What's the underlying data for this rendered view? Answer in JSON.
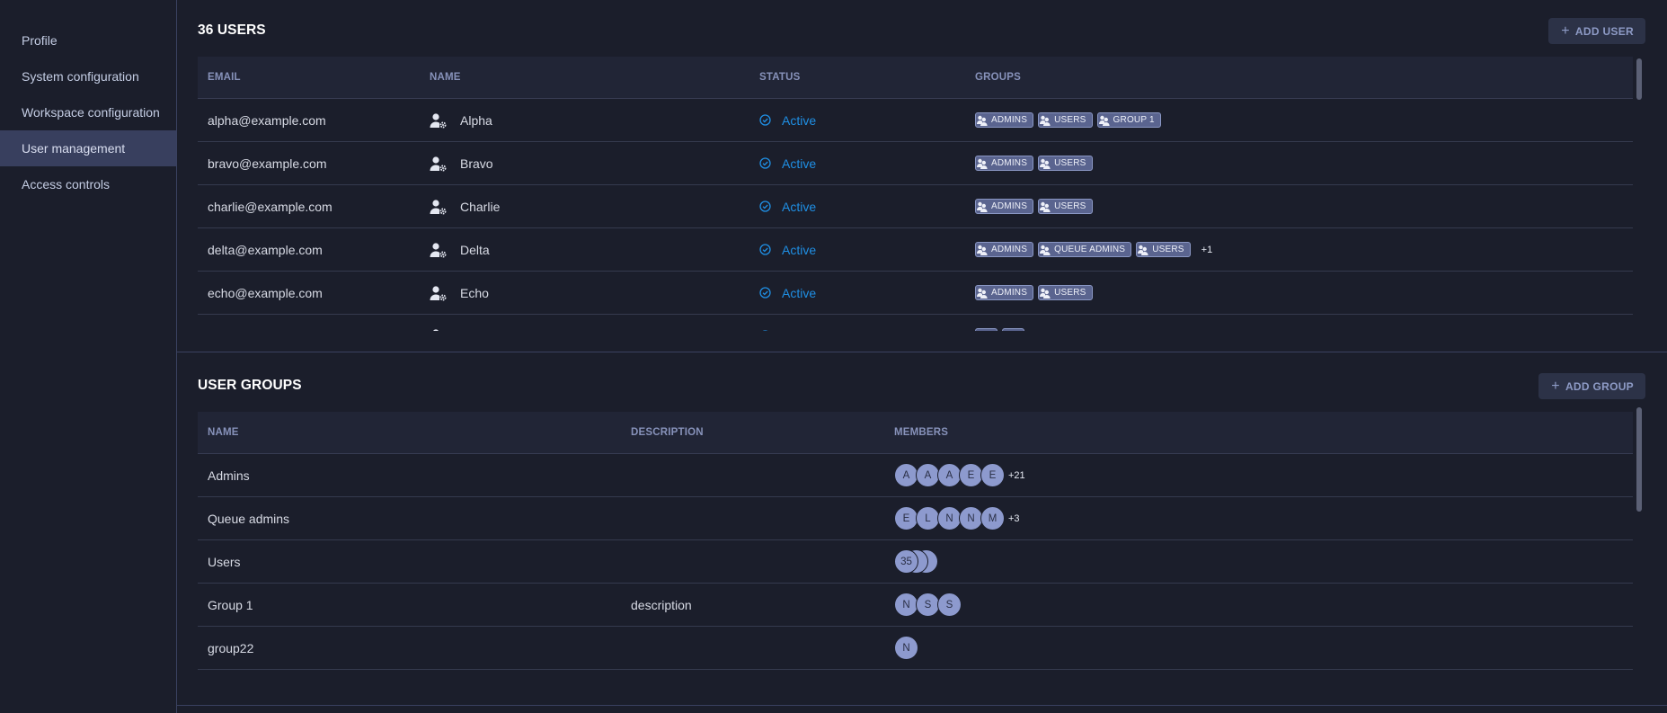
{
  "sidebar": {
    "items": [
      {
        "label": "Profile",
        "active": false
      },
      {
        "label": "System configuration",
        "active": false
      },
      {
        "label": "Workspace configuration",
        "active": false
      },
      {
        "label": "User management",
        "active": true
      },
      {
        "label": "Access controls",
        "active": false
      }
    ]
  },
  "users": {
    "title": "36 USERS",
    "add_button": "ADD USER",
    "columns": [
      "EMAIL",
      "NAME",
      "STATUS",
      "GROUPS"
    ],
    "rows": [
      {
        "email": "alpha@example.com",
        "name": "Alpha",
        "status": "Active",
        "groups": [
          "ADMINS",
          "USERS",
          "GROUP 1"
        ],
        "more": ""
      },
      {
        "email": "bravo@example.com",
        "name": "Bravo",
        "status": "Active",
        "groups": [
          "ADMINS",
          "USERS"
        ],
        "more": ""
      },
      {
        "email": "charlie@example.com",
        "name": "Charlie",
        "status": "Active",
        "groups": [
          "ADMINS",
          "USERS"
        ],
        "more": ""
      },
      {
        "email": "delta@example.com",
        "name": "Delta",
        "status": "Active",
        "groups": [
          "ADMINS",
          "QUEUE ADMINS",
          "USERS"
        ],
        "more": "+1"
      },
      {
        "email": "echo@example.com",
        "name": "Echo",
        "status": "Active",
        "groups": [
          "ADMINS",
          "USERS"
        ],
        "more": ""
      },
      {
        "email": "",
        "name": "",
        "status": "",
        "groups": [
          "",
          ""
        ],
        "more": ""
      }
    ]
  },
  "groups": {
    "title": "USER GROUPS",
    "add_button": "ADD GROUP",
    "columns": [
      "NAME",
      "DESCRIPTION",
      "MEMBERS"
    ],
    "rows": [
      {
        "name": "Admins",
        "description": "",
        "members": [
          "A",
          "A",
          "A",
          "E",
          "E"
        ],
        "more": "+21",
        "stack": false
      },
      {
        "name": "Queue admins",
        "description": "",
        "members": [
          "E",
          "L",
          "N",
          "N",
          "M"
        ],
        "more": "+3",
        "stack": false
      },
      {
        "name": "Users",
        "description": "",
        "members": [
          "35"
        ],
        "more": "",
        "stack": true
      },
      {
        "name": "Group 1",
        "description": "description",
        "members": [
          "N",
          "S",
          "S"
        ],
        "more": "",
        "stack": false
      },
      {
        "name": "group22",
        "description": "",
        "members": [
          "N"
        ],
        "more": "",
        "stack": false
      }
    ]
  },
  "colors": {
    "background": "#1b1e2b",
    "accent_status": "#1f8fe4",
    "chip": "#5a648f",
    "avatar": "#8d9ace",
    "active_nav": "#383f5e"
  }
}
